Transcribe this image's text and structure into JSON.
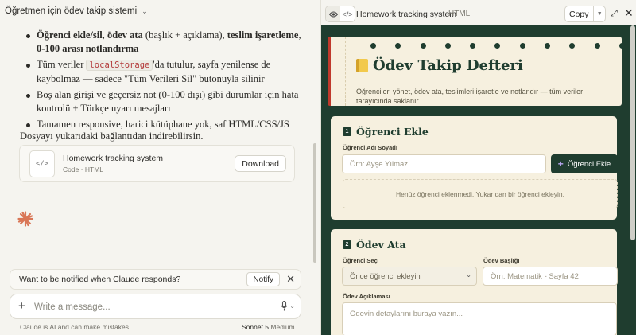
{
  "conversation": {
    "title": "Öğretmen için ödev takip sistemi"
  },
  "message": {
    "bullets": [
      {
        "bold1": "Öğrenci ekle/sil",
        "sep1": ", ",
        "bold2": "ödev ata",
        "mid": " (başlık + açıklama), ",
        "bold3": "teslim işaretleme",
        "sep3": ", ",
        "bold4": "0-100 arası notlandırma"
      },
      {
        "pre": "Tüm veriler ",
        "code": "localStorage",
        "post": "'da tutulur, sayfa yenilense de kaybolmaz — sadece \"Tüm Verileri Sil\" butonuyla silinir"
      },
      {
        "text": "Boş alan girişi ve geçersiz not (0-100 dışı) gibi durumlar için hata kontrolü + Türkçe uyarı mesajları"
      },
      {
        "text": "Tamamen responsive, harici kütüphane yok, saf HTML/CSS/JS"
      }
    ],
    "after": "Dosyayı yukarıdaki bağlantıdan indirebilirsin."
  },
  "artifact_card": {
    "name": "Homework tracking system",
    "meta": "Code · HTML",
    "download_label": "Download",
    "thumb_icon": "</>"
  },
  "notify": {
    "text": "Want to be notified when Claude responds?",
    "button": "Notify",
    "close": "✕"
  },
  "composer": {
    "placeholder": "Write a message...",
    "plus": "+"
  },
  "footer": {
    "disclaimer": "Claude is AI and can make mistakes.",
    "model": "Sonnet 5",
    "mode": "Medium"
  },
  "artifact_toolbar": {
    "title": "Homework tracking system",
    "type": "HTML",
    "copy_label": "Copy",
    "view_icon": "eye-icon",
    "code_icon": "code-icon"
  },
  "app": {
    "title": "Ödev Takip Defteri",
    "subtitle": "Öğrencileri yönet, ödev ata, teslimleri işaretle ve notlandır — tüm veriler tarayıcında saklanır.",
    "add_student": {
      "num": "1",
      "heading": "Öğrenci Ekle",
      "name_label": "Öğrenci Adı Soyadı",
      "name_placeholder": "Örn: Ayşe Yılmaz",
      "add_button": "Öğrenci Ekle",
      "empty": "Henüz öğrenci eklenmedi. Yukarıdan bir öğrenci ekleyin."
    },
    "assign": {
      "num": "2",
      "heading": "Ödev Ata",
      "student_label": "Öğrenci Seç",
      "student_selected": "Önce öğrenci ekleyin",
      "title_label": "Ödev Başlığı",
      "title_placeholder": "Örn: Matematik - Sayfa 42",
      "desc_label": "Ödev Açıklaması",
      "desc_placeholder": "Ödevin detaylarını buraya yazın..."
    }
  },
  "colors": {
    "accent_green": "#1f3d2f",
    "paper": "#f6f0df",
    "code_red": "#b33a3a",
    "claude_orange": "#d97757"
  }
}
